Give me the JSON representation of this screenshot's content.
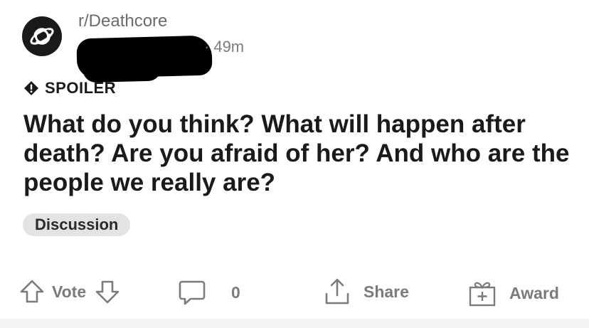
{
  "post": {
    "subreddit": "r/Deathcore",
    "age": "49m",
    "spoiler_label": "SPOILER",
    "title": "What do you think? What will happen after death? Are you afraid of her? And who are the people we really are?",
    "flair": "Discussion"
  },
  "actions": {
    "vote_label": "Vote",
    "comment_count": "0",
    "share_label": "Share",
    "award_label": "Award"
  },
  "icons": {
    "avatar": "planet-icon",
    "spoiler": "exclamation-diamond-icon",
    "upvote": "arrow-up-icon",
    "downvote": "arrow-down-icon",
    "comment": "comment-bubble-icon",
    "share": "share-icon",
    "award": "gift-icon"
  },
  "colors": {
    "text": "#1a1a1b",
    "muted": "#7b7b7b",
    "flair_bg": "#e3e3e3"
  }
}
